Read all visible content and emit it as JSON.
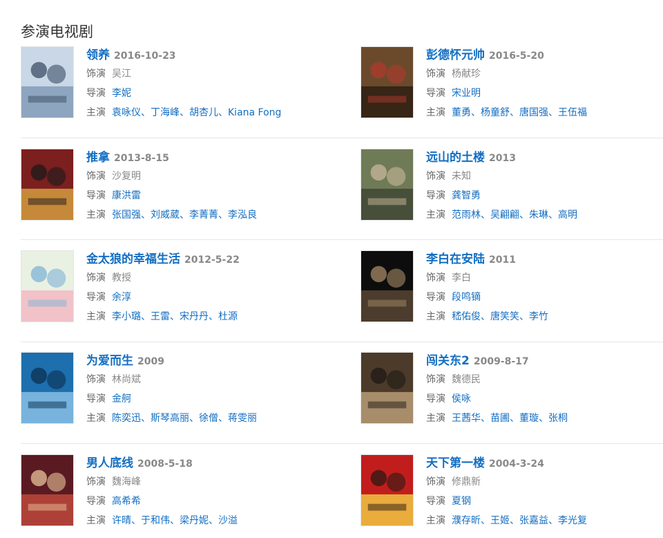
{
  "section": {
    "title": "参演电视剧"
  },
  "labels": {
    "role": "饰演",
    "director": "导演",
    "cast": "主演"
  },
  "colors": {
    "link": "#136ec2",
    "muted": "#888888",
    "label": "#666666"
  },
  "items": [
    {
      "title": "领养",
      "date": "2016-10-23",
      "role": "吴江",
      "director": "李妮",
      "cast": [
        "袁咏仪",
        "丁海峰",
        "胡杏儿",
        "Kiana Fong"
      ],
      "poster_icon": "poster-image"
    },
    {
      "title": "彭德怀元帅",
      "date": "2016-5-20",
      "role": "杨献珍",
      "director": "宋业明",
      "cast": [
        "董勇",
        "杨童舒",
        "唐国强",
        "王伍福"
      ],
      "poster_icon": "poster-image"
    },
    {
      "title": "推拿",
      "date": "2013-8-15",
      "role": "沙复明",
      "director": "康洪雷",
      "cast": [
        "张国强",
        "刘威葳",
        "李菁菁",
        "李泓良"
      ],
      "poster_icon": "poster-image"
    },
    {
      "title": "远山的土楼",
      "date": "2013",
      "role": "未知",
      "director": "龚智勇",
      "cast": [
        "范雨林",
        "吴翩翩",
        "朱琳",
        "高明"
      ],
      "poster_icon": "poster-image"
    },
    {
      "title": "金太狼的幸福生活",
      "date": "2012-5-22",
      "role": "教授",
      "director": "余淳",
      "cast": [
        "李小璐",
        "王雷",
        "宋丹丹",
        "杜源"
      ],
      "poster_icon": "poster-image"
    },
    {
      "title": "李白在安陆",
      "date": "2011",
      "role": "李白",
      "director": "段鸣镝",
      "cast": [
        "嵇佑俊",
        "唐笑笑",
        "李竹"
      ],
      "poster_icon": "poster-image"
    },
    {
      "title": "为爱而生",
      "date": "2009",
      "role": "林尚斌",
      "director": "金舸",
      "cast": [
        "陈奕迅",
        "斯琴高丽",
        "徐僧",
        "蒋雯丽"
      ],
      "poster_icon": "poster-image"
    },
    {
      "title": "闯关东2",
      "date": "2009-8-17",
      "role": "魏德民",
      "director": "侯咏",
      "cast": [
        "王茜华",
        "苗圃",
        "董璇",
        "张桐"
      ],
      "poster_icon": "poster-image"
    },
    {
      "title": "男人底线",
      "date": "2008-5-18",
      "role": "魏海峰",
      "director": "高希希",
      "cast": [
        "许晴",
        "于和伟",
        "梁丹妮",
        "沙溢"
      ],
      "poster_icon": "poster-image"
    },
    {
      "title": "天下第一楼",
      "date": "2004-3-24",
      "role": "修鼎新",
      "director": "夏钢",
      "cast": [
        "濮存昕",
        "王姬",
        "张嘉益",
        "李光复"
      ],
      "poster_icon": "poster-image"
    }
  ]
}
